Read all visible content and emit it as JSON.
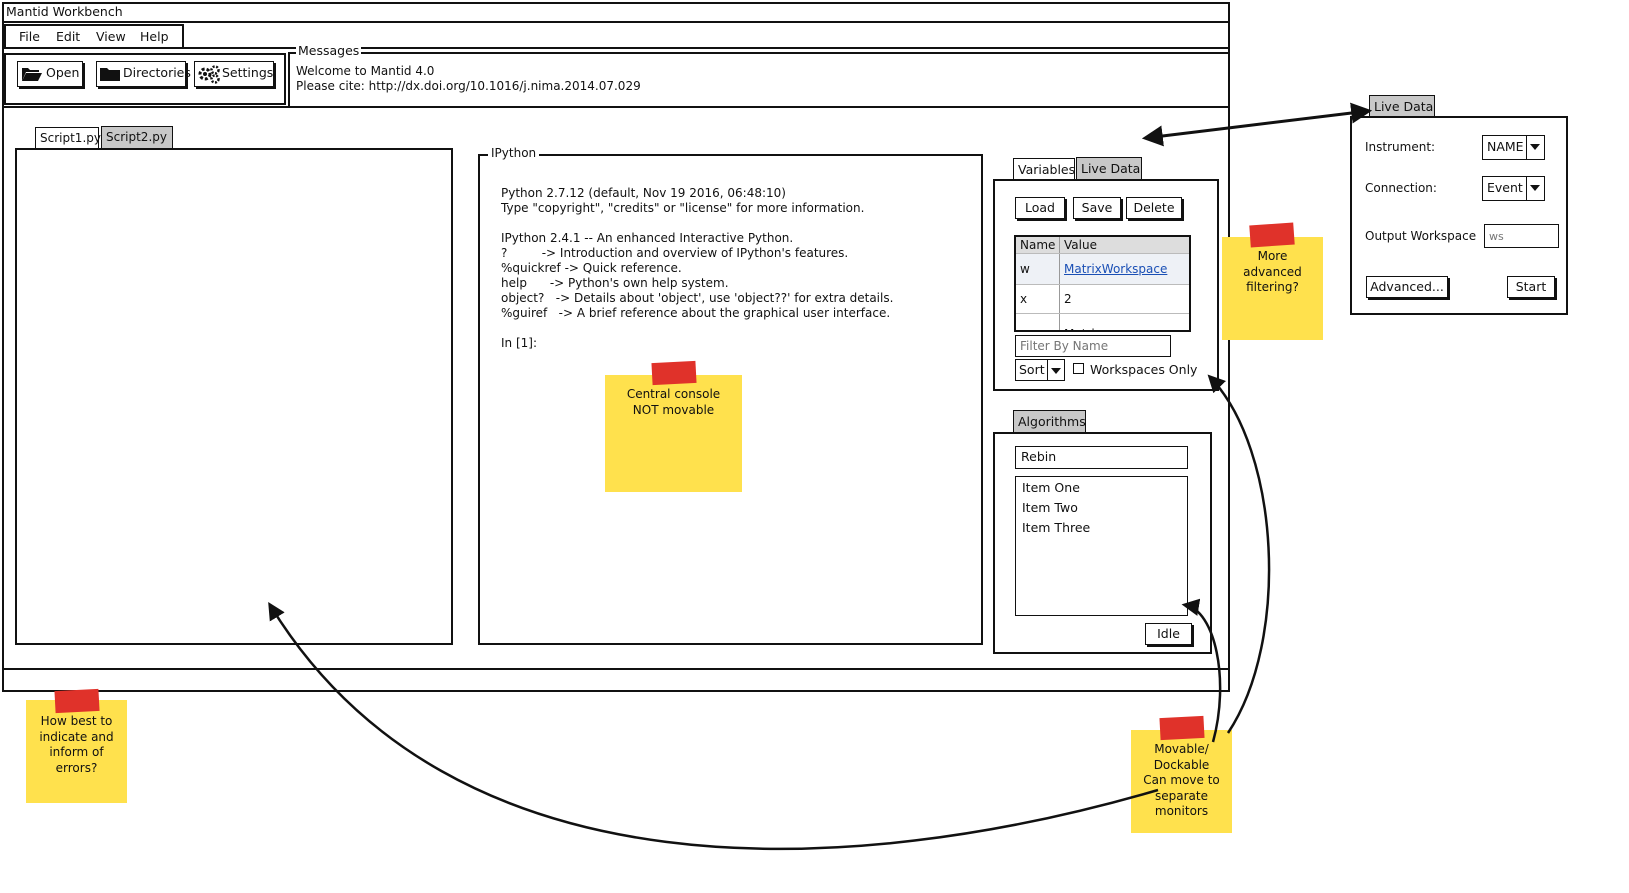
{
  "window": {
    "title": "Mantid Workbench"
  },
  "menu": {
    "items": [
      "File",
      "Edit",
      "View",
      "Help"
    ]
  },
  "toolbar": {
    "open_label": "Open",
    "directories_label": "Directories",
    "settings_label": "Settings"
  },
  "messages": {
    "title": "Messages",
    "lines": [
      "Welcome to Mantid 4.0",
      "Please cite: http://dx.doi.org/10.1016/j.nima.2014.07.029"
    ]
  },
  "editor": {
    "tabs": [
      "Script1.py",
      "Script2.py"
    ]
  },
  "ipython": {
    "title": "IPython",
    "lines": [
      "Python 2.7.12 (default, Nov 19 2016, 06:48:10)",
      "Type \"copyright\", \"credits\" or \"license\" for more information.",
      "",
      "IPython 2.4.1 -- An enhanced Interactive Python.",
      "?         -> Introduction and overview of IPython's features.",
      "%quickref -> Quick reference.",
      "help      -> Python's own help system.",
      "object?   -> Details about 'object', use 'object??' for extra details.",
      "%guiref   -> A brief reference about the graphical user interface.",
      "",
      "In [1]:"
    ]
  },
  "variables": {
    "tabs": [
      "Variables",
      "Live Data"
    ],
    "buttons": {
      "load": "Load",
      "save": "Save",
      "delete": "Delete"
    },
    "table": {
      "headers": [
        "Name",
        "Value"
      ],
      "rows": [
        [
          "w",
          "MatrixWorkspace"
        ],
        [
          "x",
          "2"
        ],
        [
          "z",
          "Matrix"
        ]
      ]
    },
    "filter_placeholder": "Filter By Name",
    "sort_label": "Sort",
    "workspaces_only_label": "Workspaces Only"
  },
  "algorithms": {
    "tab": "Algorithms",
    "search_value": "Rebin",
    "items": [
      "Item One",
      "Item Two",
      "Item Three"
    ],
    "status": "Idle"
  },
  "live_data": {
    "tab": "Live Data",
    "instrument_label": "Instrument:",
    "instrument_value": "NAME",
    "connection_label": "Connection:",
    "connection_value": "Event",
    "output_label": "Output Workspace",
    "output_placeholder": "ws",
    "advanced_label": "Advanced...",
    "start_label": "Start"
  },
  "notes": {
    "central": "Central console\nNOT movable",
    "filtering": "More\nadvanced\nfiltering?",
    "errors": "How best to\nindicate and\ninform of\nerrors?",
    "movable": "Movable/\nDockable\nCan move to\nseparate\nmonitors"
  },
  "colors": {
    "note": "#ffe14d",
    "tape": "#e0322a",
    "link": "#1a4fb5",
    "tab_inactive": "#c8c8c8"
  }
}
